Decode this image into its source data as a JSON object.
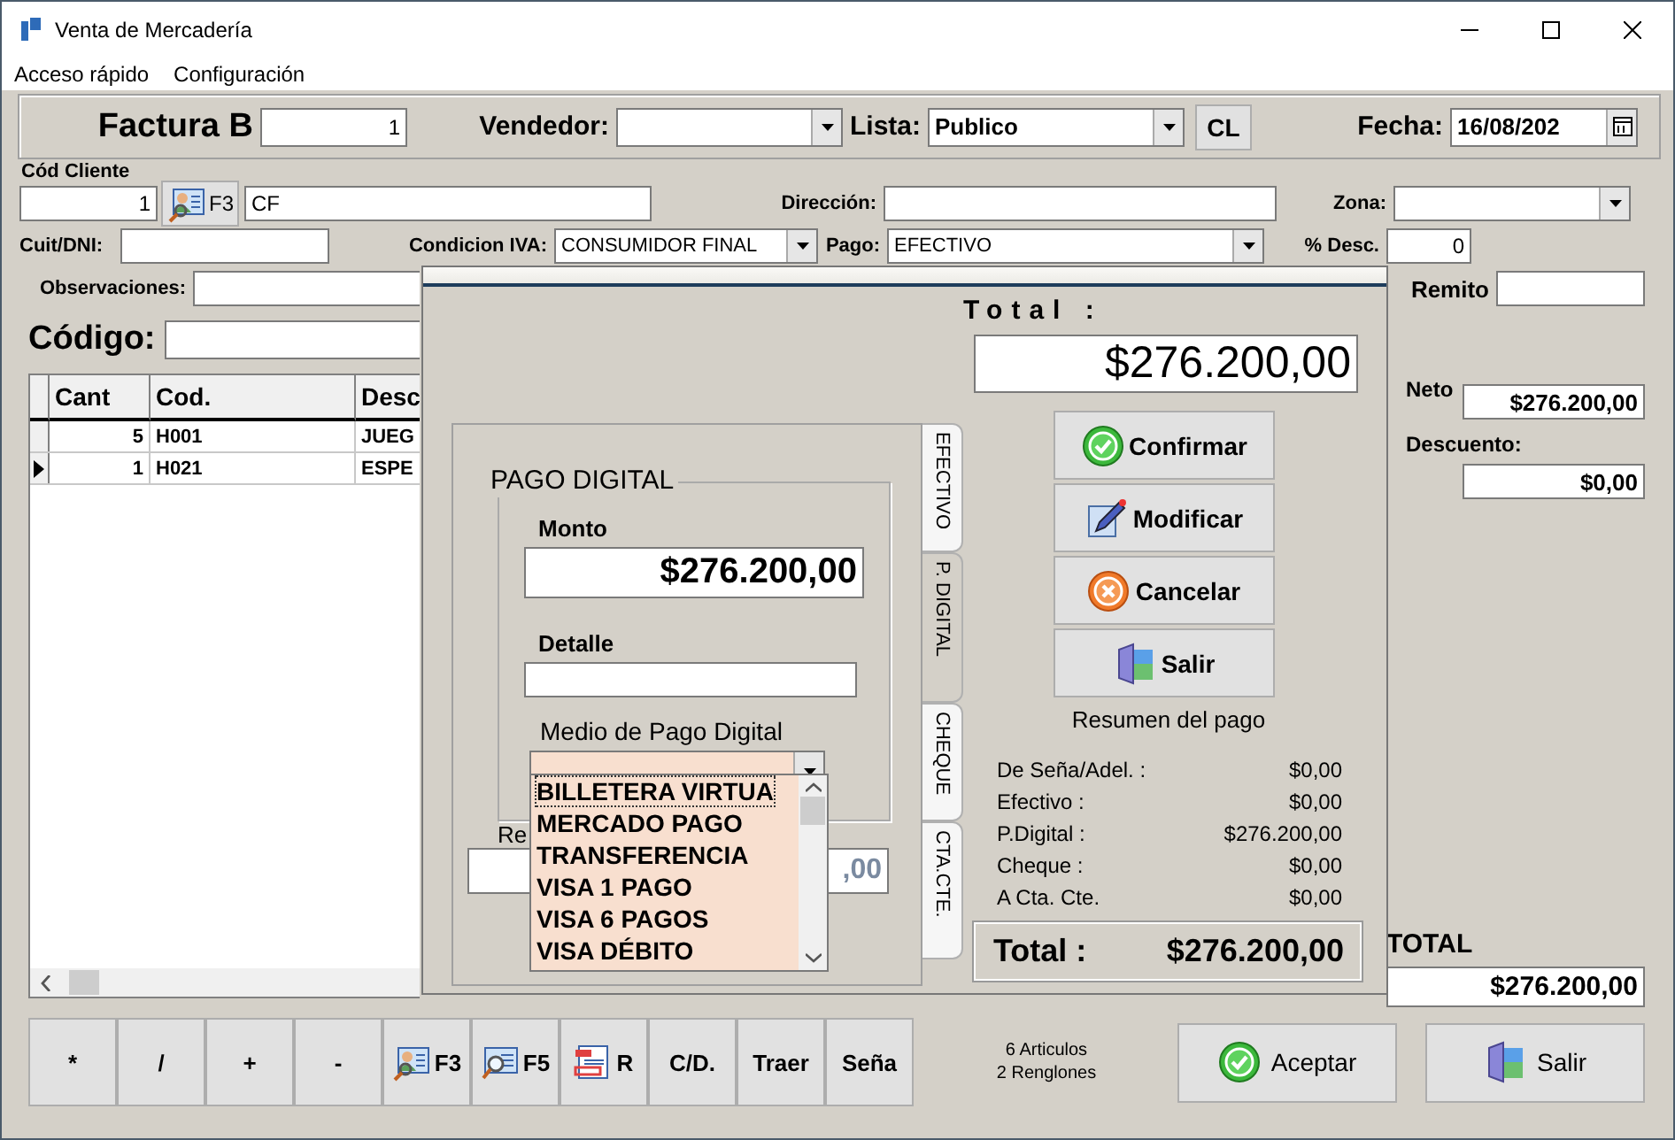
{
  "window": {
    "title": "Venta de Mercadería"
  },
  "menu": [
    "Acceso rápido",
    "Configuración"
  ],
  "header": {
    "doc_label": "Factura B",
    "doc_number": "1",
    "vendedor_label": "Vendedor:",
    "lista_label": "Lista:",
    "lista_value": "Publico",
    "cl_button": "CL",
    "fecha_label": "Fecha:",
    "fecha_value": "16/08/202"
  },
  "client": {
    "code_label": "Cód Cliente",
    "code_value": "1",
    "search_key": "F3",
    "name_value": "CF",
    "direccion_label": "Dirección:",
    "zona_label": "Zona:",
    "cuit_label": "Cuit/DNI:",
    "iva_label": "Condicion IVA:",
    "iva_value": "CONSUMIDOR FINAL",
    "pago_label": "Pago:",
    "pago_value": "EFECTIVO",
    "desc_label": "% Desc.",
    "desc_value": "0",
    "obs_label": "Observaciones:",
    "remito_label": "Remito"
  },
  "codigo_label": "Código:",
  "grid": {
    "columns": [
      "Cant",
      "Cod.",
      "Desc"
    ],
    "rows": [
      {
        "cells": [
          "5",
          "H001",
          "JUEG"
        ],
        "selected": false
      },
      {
        "cells": [
          "1",
          "H021",
          "ESPE"
        ],
        "selected": true
      }
    ]
  },
  "totals": {
    "neto_label": "Neto",
    "neto_value": "$276.200,00",
    "descuento_label": "Descuento:",
    "descuento_value": "$0,00",
    "total_label": "TOTAL",
    "total_value": "$276.200,00"
  },
  "keys": [
    {
      "label": "*",
      "kind": "text"
    },
    {
      "label": "/",
      "kind": "text"
    },
    {
      "label": "+",
      "kind": "text"
    },
    {
      "label": "-",
      "kind": "text"
    },
    {
      "label": "F3",
      "kind": "client"
    },
    {
      "label": "F5",
      "kind": "search"
    },
    {
      "label": "R",
      "kind": "list"
    },
    {
      "label": "C/D.",
      "kind": "text"
    },
    {
      "label": "Traer",
      "kind": "text"
    },
    {
      "label": "Seña",
      "kind": "text"
    }
  ],
  "status": [
    "6 Articulos",
    "2 Renglones"
  ],
  "actions": [
    {
      "label": "Aceptar",
      "kind": "confirm"
    },
    {
      "label": "Salir",
      "kind": "exit"
    }
  ],
  "dialog": {
    "total_label": "Total :",
    "total_value": "$276.200,00",
    "tabs": [
      {
        "label": "EFECTIVO",
        "selected": false
      },
      {
        "label": "P. DIGITAL",
        "selected": true
      },
      {
        "label": "CHEQUE",
        "selected": false
      },
      {
        "label": "CTA.CTE.",
        "selected": false
      }
    ],
    "group_title": "PAGO DIGITAL",
    "monto_label": "Monto",
    "monto_value": "$276.200,00",
    "detalle_label": "Detalle",
    "medio_label": "Medio de Pago Digital",
    "options": [
      {
        "label": "BILLETERA VIRTUA",
        "selected": true
      },
      {
        "label": "MERCADO PAGO",
        "selected": false
      },
      {
        "label": "TRANSFERENCIA",
        "selected": false
      },
      {
        "label": "VISA 1 PAGO",
        "selected": false
      },
      {
        "label": "VISA 6 PAGOS",
        "selected": false
      },
      {
        "label": "VISA DÉBITO",
        "selected": false
      }
    ],
    "resto_label": "Re",
    "resto_value": ",00",
    "buttons": [
      {
        "label": "Confirmar",
        "kind": "confirm"
      },
      {
        "label": "Modificar",
        "kind": "edit"
      },
      {
        "label": "Cancelar",
        "kind": "cancel"
      },
      {
        "label": "Salir",
        "kind": "exit"
      }
    ],
    "summary_title": "Resumen del pago",
    "summary": [
      {
        "label": "De Seña/Adel. :",
        "value": "$0,00"
      },
      {
        "label": "Efectivo :",
        "value": "$0,00"
      },
      {
        "label": "P.Digital :",
        "value": "$276.200,00"
      },
      {
        "label": "Cheque :",
        "value": "$0,00"
      },
      {
        "label": "A Cta. Cte.",
        "value": "$0,00"
      }
    ],
    "summary_total_label": "Total :",
    "summary_total_value": "$276.200,00"
  }
}
